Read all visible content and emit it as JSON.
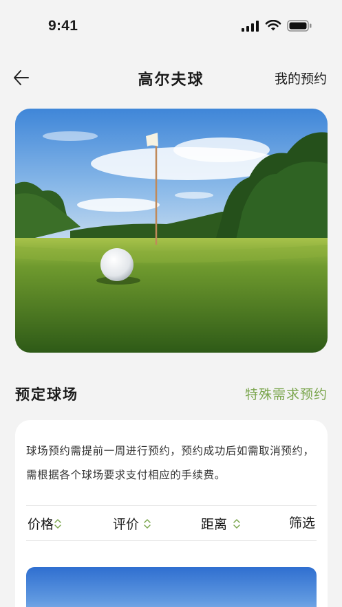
{
  "status_bar": {
    "time": "9:41"
  },
  "nav": {
    "title": "高尔夫球",
    "right_action": "我的预约"
  },
  "hero": {
    "alt": "golf-course-photo"
  },
  "section": {
    "title": "预定球场",
    "link": "特殊需求预约"
  },
  "card": {
    "notice": "球场预约需提前一周进行预约，预约成功后如需取消预约，需根据各个球场要求支付相应的手续费。",
    "filters": [
      {
        "label": "价格"
      },
      {
        "label": "评价"
      },
      {
        "label": "距离"
      },
      {
        "label": "筛选"
      }
    ]
  },
  "colors": {
    "accent": "#7aa54c",
    "background": "#f3f3f3",
    "card": "#ffffff"
  }
}
